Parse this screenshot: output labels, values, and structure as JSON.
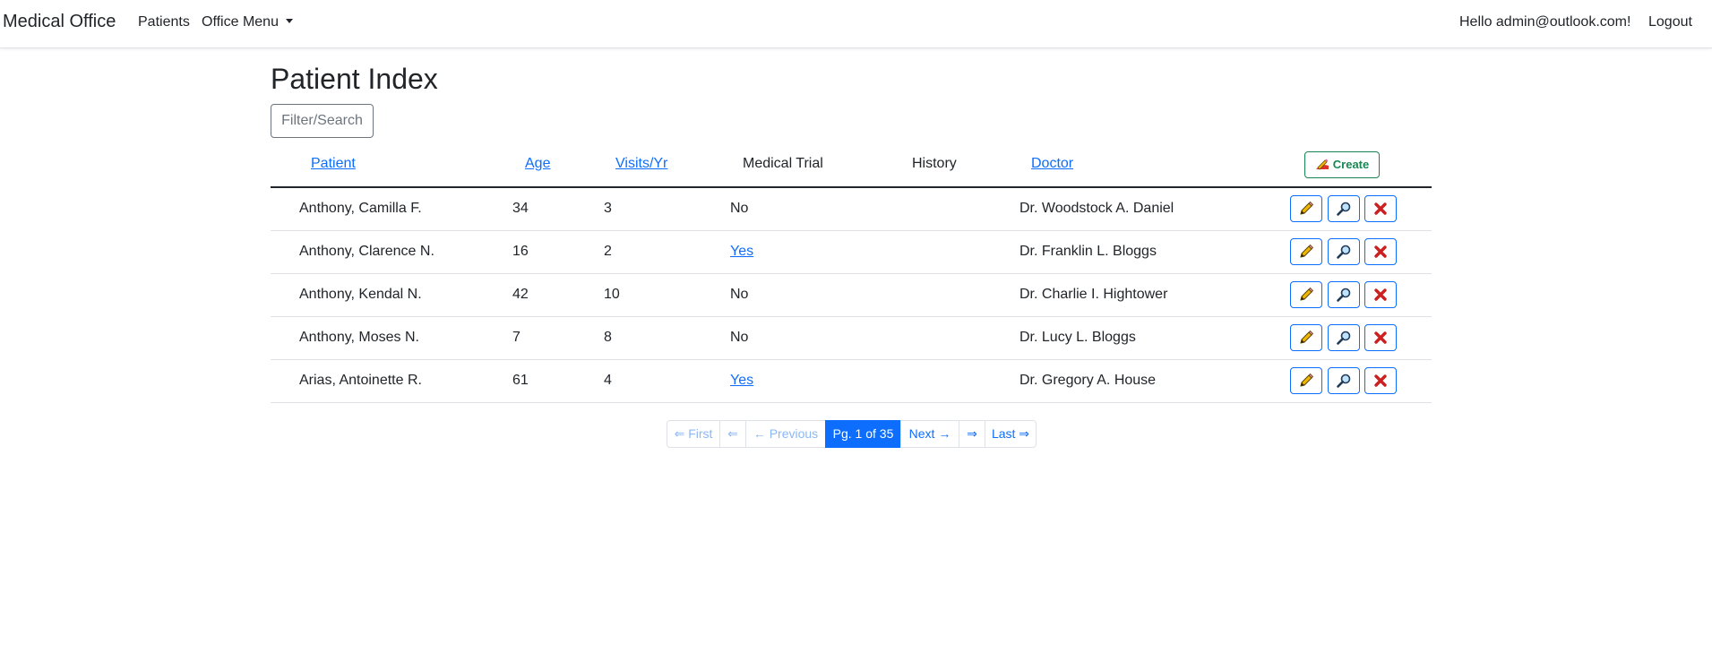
{
  "navbar": {
    "brand": "Medical Office",
    "patients_link": "Patients",
    "office_menu": "Office Menu",
    "greeting": "Hello admin@outlook.com!",
    "logout": "Logout"
  },
  "page": {
    "title": "Patient Index",
    "filter_button": "Filter/Search"
  },
  "table": {
    "headers": {
      "patient": "Patient",
      "age": "Age",
      "visits": "Visits/Yr",
      "medical_trial": "Medical Trial",
      "history": "History",
      "doctor": "Doctor"
    },
    "create_button": "Create",
    "rows": [
      {
        "patient": "Anthony, Camilla F.",
        "age": "34",
        "visits": "3",
        "trial": "No",
        "history": "",
        "doctor": "Dr. Woodstock A. Daniel"
      },
      {
        "patient": "Anthony, Clarence N.",
        "age": "16",
        "visits": "2",
        "trial": "Yes",
        "history": "",
        "doctor": "Dr. Franklin L. Bloggs"
      },
      {
        "patient": "Anthony, Kendal N.",
        "age": "42",
        "visits": "10",
        "trial": "No",
        "history": "",
        "doctor": "Dr. Charlie I. Hightower"
      },
      {
        "patient": "Anthony, Moses N.",
        "age": "7",
        "visits": "8",
        "trial": "No",
        "history": "",
        "doctor": "Dr. Lucy L. Bloggs"
      },
      {
        "patient": "Arias, Antoinette R.",
        "age": "61",
        "visits": "4",
        "trial": "Yes",
        "history": "",
        "doctor": "Dr. Gregory A. House"
      }
    ],
    "row_actions": [
      "pencil-icon",
      "magnifier-icon",
      "red-x-icon"
    ]
  },
  "pager": {
    "first": "⇐ First",
    "prev_arrow": "⇐",
    "previous": "← Previous",
    "current": "Pg. 1 of 35",
    "next": "Next →",
    "next_arrow": "⇒",
    "last": "Last ⇒"
  },
  "colors": {
    "link": "#0d6efd",
    "create": "#198754",
    "delete": "#cc1f1f",
    "pencil": "#f2b705"
  }
}
